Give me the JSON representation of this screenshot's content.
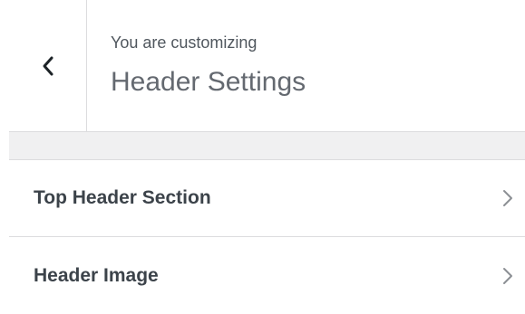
{
  "header": {
    "subtitle": "You are customizing",
    "title": "Header Settings",
    "back_icon": "chevron-left-icon"
  },
  "sections": [
    {
      "label": "Top Header Section",
      "icon": "chevron-right-icon"
    },
    {
      "label": "Header Image",
      "icon": "chevron-right-icon"
    }
  ],
  "colors": {
    "text_primary": "#3c434a",
    "text_secondary": "#646970",
    "divider": "#dcdcde",
    "band": "#f0f0f1"
  }
}
